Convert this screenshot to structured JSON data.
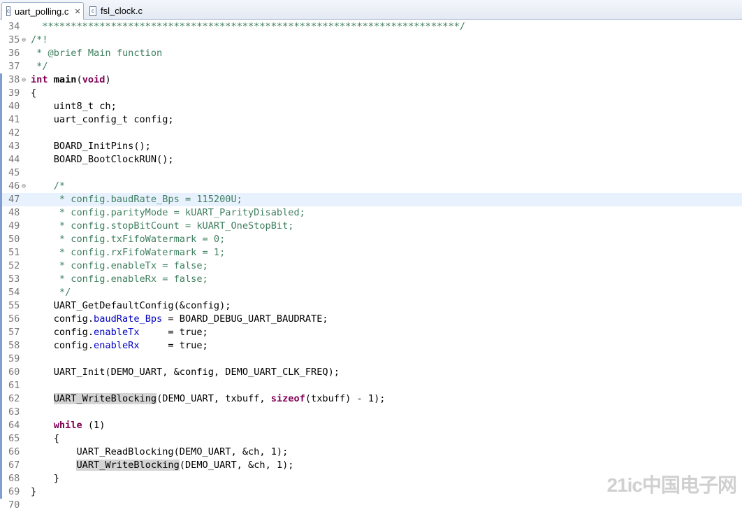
{
  "tabs": [
    {
      "label": "uart_polling.c",
      "close": "✕",
      "icon": "c-file-icon",
      "active": true
    },
    {
      "label": "fsl_clock.c",
      "icon": "c-file-icon",
      "active": false
    }
  ],
  "colors": {
    "keyword": "#7f0055",
    "comment": "#3f7f5f",
    "field": "#0000c0",
    "current_line": "#e8f2fe",
    "change_bar": "#7f9fd3"
  },
  "current_line": "47",
  "lines": [
    {
      "n": "34",
      "t": [
        {
          "s": "  *************************************************************************/",
          "c": "cm"
        }
      ]
    },
    {
      "n": "35",
      "fold": true,
      "t": [
        {
          "s": "/*!",
          "c": "cm"
        }
      ]
    },
    {
      "n": "36",
      "t": [
        {
          "s": " * @brief Main function",
          "c": "cm"
        }
      ]
    },
    {
      "n": "37",
      "t": [
        {
          "s": " */",
          "c": "cm"
        }
      ]
    },
    {
      "n": "38",
      "fold": true,
      "t": [
        {
          "s": "int",
          "c": "kw"
        },
        {
          "s": " "
        },
        {
          "s": "main",
          "c": "fn"
        },
        {
          "s": "("
        },
        {
          "s": "void",
          "c": "kw"
        },
        {
          "s": ")"
        }
      ]
    },
    {
      "n": "39",
      "t": [
        {
          "s": "{"
        }
      ]
    },
    {
      "n": "40",
      "t": [
        {
          "s": "    uint8_t ch;"
        }
      ]
    },
    {
      "n": "41",
      "t": [
        {
          "s": "    uart_config_t config;"
        }
      ]
    },
    {
      "n": "42",
      "t": []
    },
    {
      "n": "43",
      "t": [
        {
          "s": "    BOARD_InitPins();"
        }
      ]
    },
    {
      "n": "44",
      "t": [
        {
          "s": "    BOARD_BootClockRUN();"
        }
      ]
    },
    {
      "n": "45",
      "t": []
    },
    {
      "n": "46",
      "fold": true,
      "t": [
        {
          "s": "    /*",
          "c": "cm"
        }
      ]
    },
    {
      "n": "47",
      "t": [
        {
          "s": "     * config.baudRate_Bps = 115200U;",
          "c": "cm"
        }
      ]
    },
    {
      "n": "48",
      "t": [
        {
          "s": "     * config.parityMode = kUART_ParityDisabled;",
          "c": "cm"
        }
      ]
    },
    {
      "n": "49",
      "t": [
        {
          "s": "     * config.stopBitCount = kUART_OneStopBit;",
          "c": "cm"
        }
      ]
    },
    {
      "n": "50",
      "t": [
        {
          "s": "     * config.txFifoWatermark = 0;",
          "c": "cm"
        }
      ]
    },
    {
      "n": "51",
      "t": [
        {
          "s": "     * config.rxFifoWatermark = 1;",
          "c": "cm"
        }
      ]
    },
    {
      "n": "52",
      "t": [
        {
          "s": "     * config.enableTx = false;",
          "c": "cm"
        }
      ]
    },
    {
      "n": "53",
      "t": [
        {
          "s": "     * config.enableRx = false;",
          "c": "cm"
        }
      ]
    },
    {
      "n": "54",
      "t": [
        {
          "s": "     */",
          "c": "cm"
        }
      ]
    },
    {
      "n": "55",
      "t": [
        {
          "s": "    UART_GetDefaultConfig(&config);"
        }
      ]
    },
    {
      "n": "56",
      "t": [
        {
          "s": "    config."
        },
        {
          "s": "baudRate_Bps",
          "c": "fld"
        },
        {
          "s": " = BOARD_DEBUG_UART_BAUDRATE;"
        }
      ]
    },
    {
      "n": "57",
      "t": [
        {
          "s": "    config."
        },
        {
          "s": "enableTx",
          "c": "fld"
        },
        {
          "s": "     = true;"
        }
      ]
    },
    {
      "n": "58",
      "t": [
        {
          "s": "    config."
        },
        {
          "s": "enableRx",
          "c": "fld"
        },
        {
          "s": "     = true;"
        }
      ]
    },
    {
      "n": "59",
      "t": []
    },
    {
      "n": "60",
      "t": [
        {
          "s": "    UART_Init(DEMO_UART, &config, DEMO_UART_CLK_FREQ);"
        }
      ]
    },
    {
      "n": "61",
      "t": []
    },
    {
      "n": "62",
      "t": [
        {
          "s": "    "
        },
        {
          "s": "UART_WriteBlocking",
          "c": "occ"
        },
        {
          "s": "(DEMO_UART, txbuff, "
        },
        {
          "s": "sizeof",
          "c": "kw"
        },
        {
          "s": "(txbuff) - 1);"
        }
      ]
    },
    {
      "n": "63",
      "t": []
    },
    {
      "n": "64",
      "t": [
        {
          "s": "    "
        },
        {
          "s": "while",
          "c": "kw"
        },
        {
          "s": " (1)"
        }
      ]
    },
    {
      "n": "65",
      "t": [
        {
          "s": "    {"
        }
      ]
    },
    {
      "n": "66",
      "t": [
        {
          "s": "        UART_ReadBlocking(DEMO_UART, &ch, 1);"
        }
      ]
    },
    {
      "n": "67",
      "t": [
        {
          "s": "        "
        },
        {
          "s": "UART_WriteBlocking",
          "c": "occ"
        },
        {
          "s": "(DEMO_UART, &ch, 1);"
        }
      ]
    },
    {
      "n": "68",
      "t": [
        {
          "s": "    }"
        }
      ]
    },
    {
      "n": "69",
      "t": [
        {
          "s": "}"
        }
      ]
    },
    {
      "n": "70",
      "t": []
    }
  ],
  "change_bar_lines": [
    "38",
    "39",
    "40",
    "41",
    "42",
    "43",
    "44",
    "45",
    "46",
    "47",
    "48",
    "49",
    "50",
    "51",
    "52",
    "53",
    "54",
    "55",
    "56",
    "57",
    "58",
    "59",
    "60",
    "61",
    "62",
    "63",
    "64",
    "65",
    "66",
    "67",
    "68",
    "69"
  ],
  "watermark": "21ic中国电子网"
}
